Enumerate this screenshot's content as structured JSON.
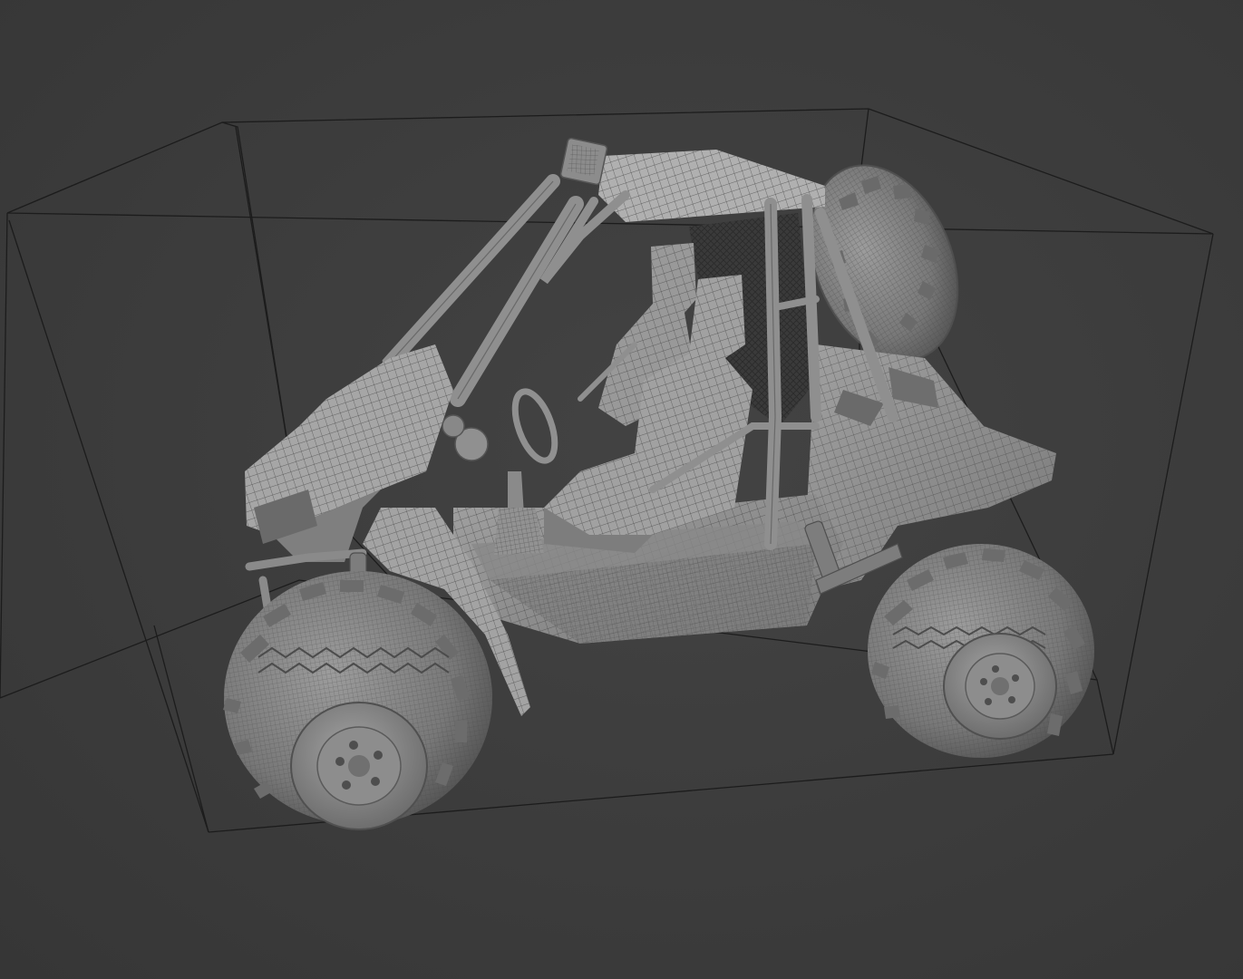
{
  "scene": {
    "subject": "buggy-model",
    "display_mode": "wireframe-on-solid",
    "colors": {
      "background": "#3d3d3d",
      "model_base": "#8a8a8a",
      "model_light": "#a8a8a8",
      "model_dark": "#5a5a5a",
      "wire": "#4a4a4a",
      "bounding_box": "#1a1a1a"
    }
  }
}
